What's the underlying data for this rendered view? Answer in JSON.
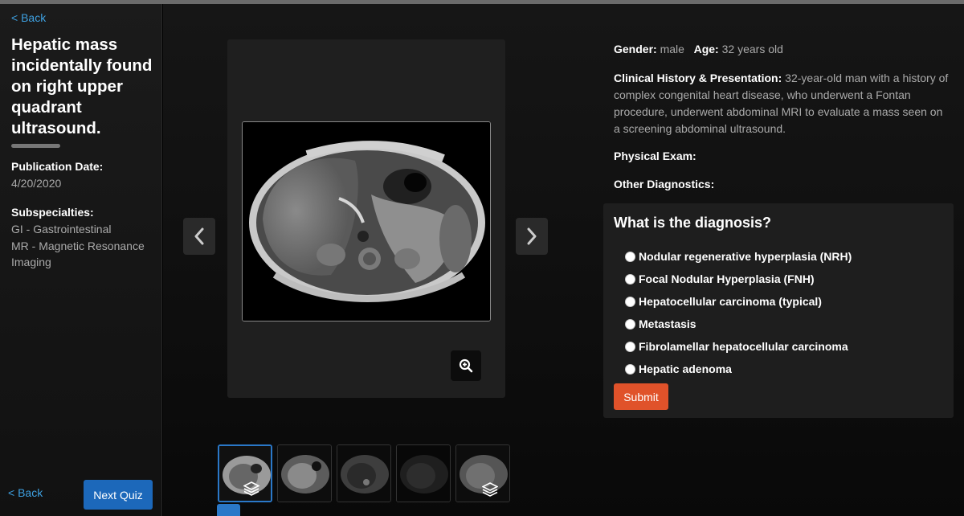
{
  "nav": {
    "back_top": "< Back",
    "back_bottom": "< Back",
    "next_quiz": "Next Quiz"
  },
  "case": {
    "title": "Hepatic mass incidentally found on right upper quadrant ultrasound.",
    "publication_label": "Publication Date:",
    "publication_date": "4/20/2020",
    "subspecialties_label": "Subspecialties:",
    "subspecialties": [
      "GI - Gastrointestinal",
      "MR - Magnetic Resonance Imaging"
    ]
  },
  "patient": {
    "gender_label": "Gender:",
    "gender": "male",
    "age_label": "Age:",
    "age": "32 years old",
    "history_label": "Clinical History & Presentation:",
    "history": "32-year-old man with a history of complex congenital heart disease, who underwent a Fontan procedure, underwent abdominal MRI to evaluate a mass seen on a screening abdominal ultrasound.",
    "exam_label": "Physical Exam:",
    "other_label": "Other Diagnostics:"
  },
  "quiz": {
    "question": "What is the diagnosis?",
    "options": [
      "Nodular regenerative hyperplasia (NRH)",
      "Focal Nodular Hyperplasia (FNH)",
      "Hepatocellular carcinoma (typical)",
      "Metastasis",
      "Fibrolamellar hepatocellular carcinoma",
      "Hepatic adenoma"
    ],
    "submit_label": "Submit"
  },
  "viewer": {
    "icons": {
      "prev": "chevron-left-icon",
      "next": "chevron-right-icon",
      "zoom": "zoom-in-icon",
      "stack": "layers-icon"
    }
  },
  "colors": {
    "link": "#3ea0e0",
    "primary": "#1c68ba",
    "submit": "#e0522a"
  }
}
